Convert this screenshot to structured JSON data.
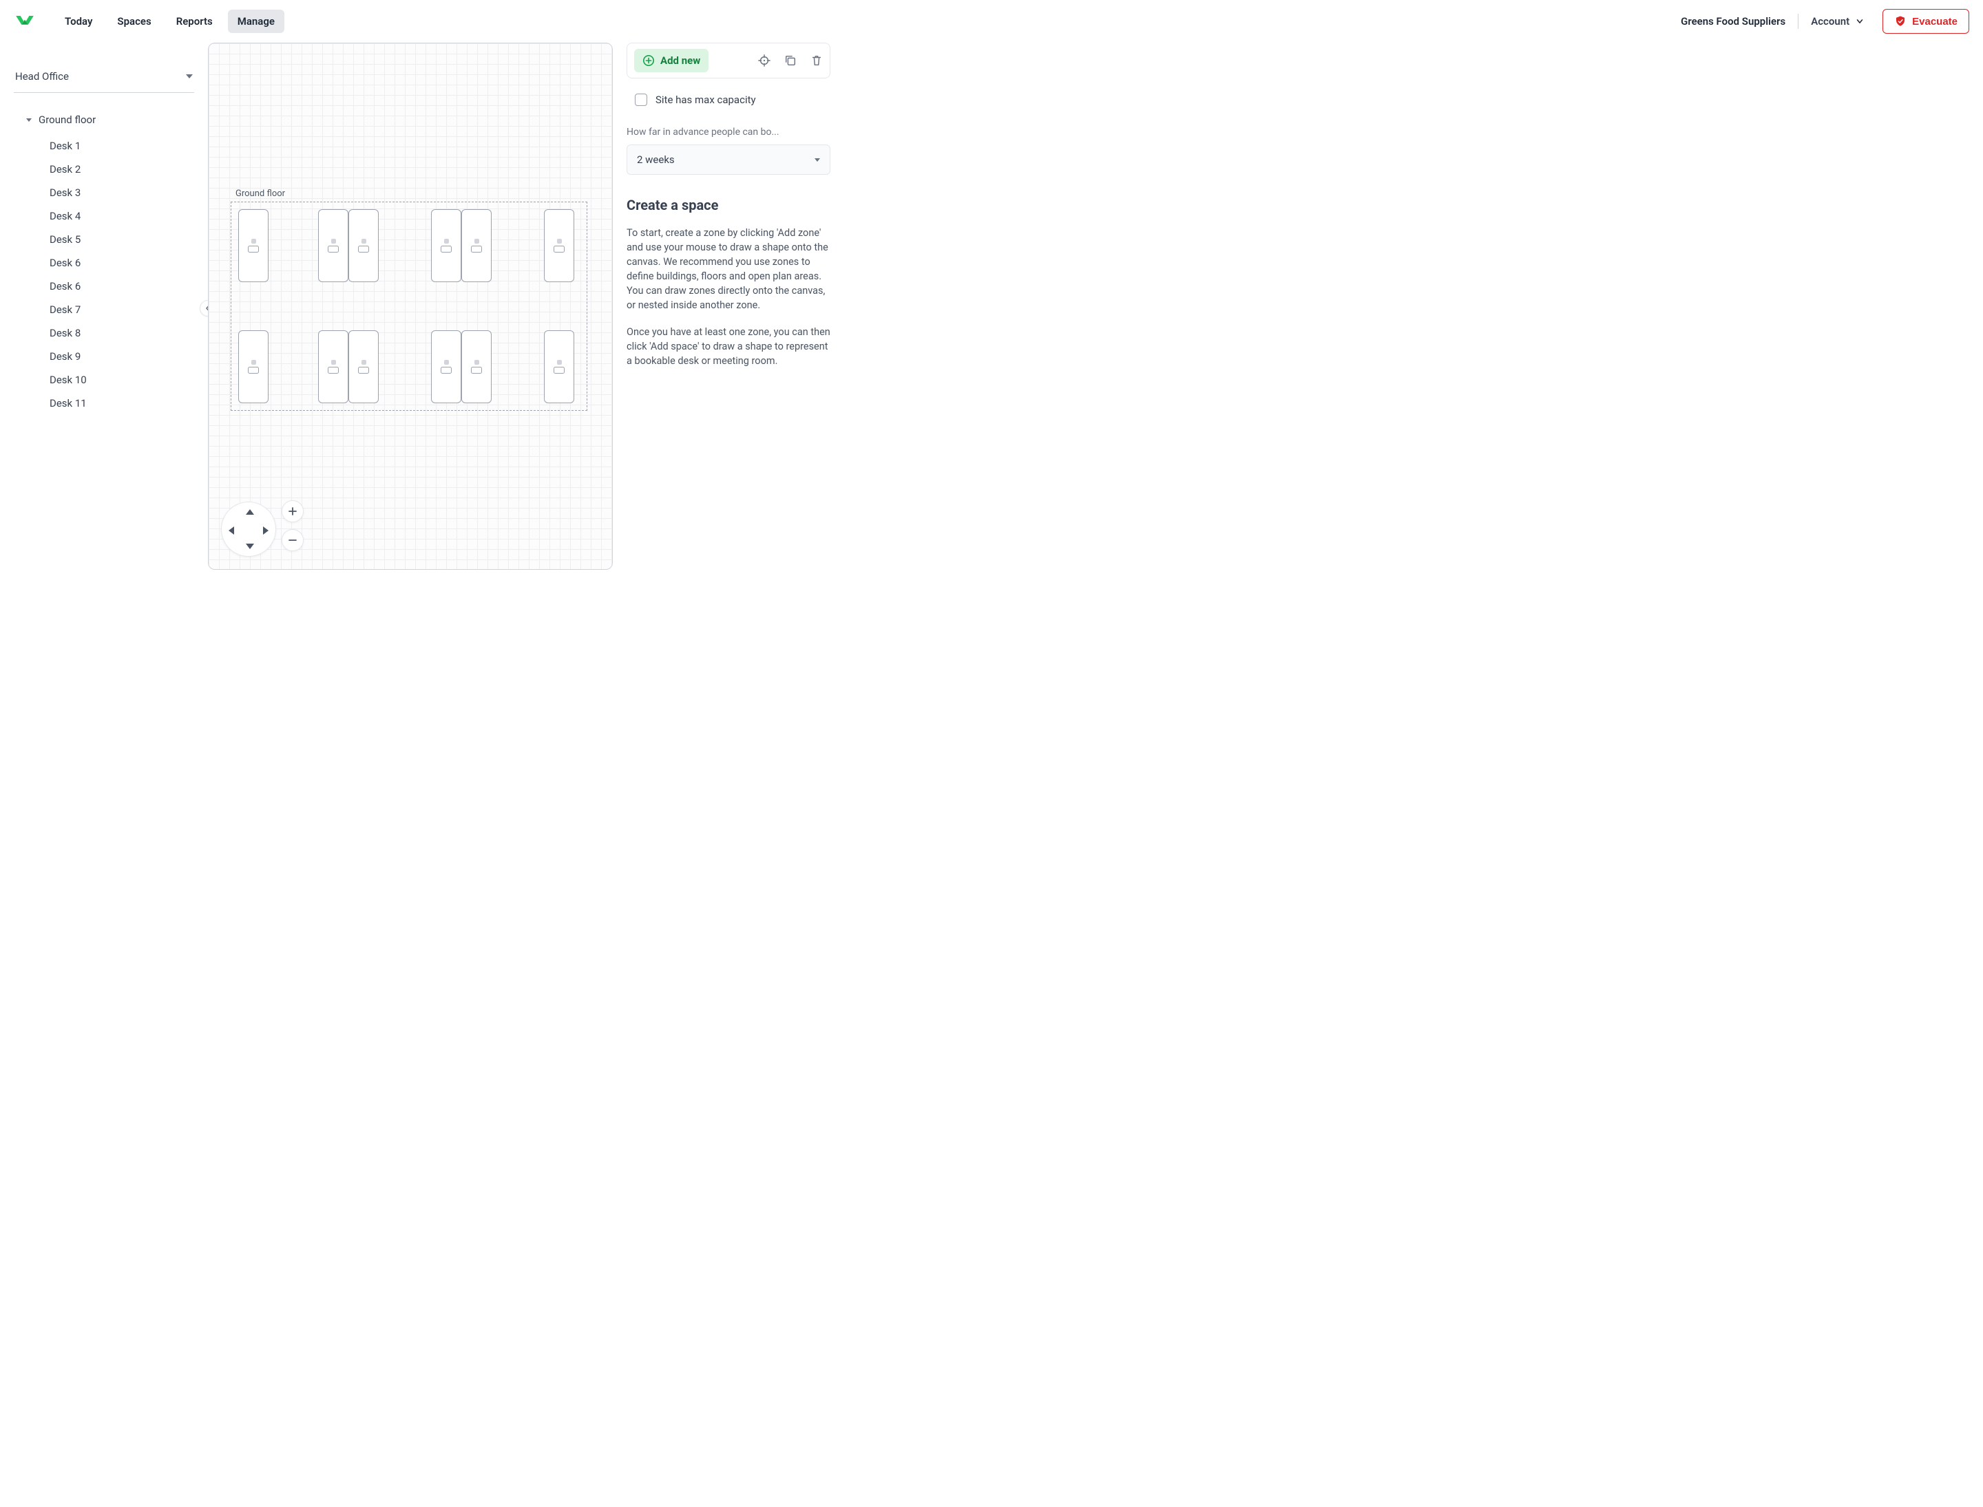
{
  "nav": {
    "items": [
      "Today",
      "Spaces",
      "Reports",
      "Manage"
    ],
    "active_index": 3
  },
  "header": {
    "org": "Greens Food Suppliers",
    "account_label": "Account",
    "evacuate_label": "Evacuate"
  },
  "sidebar": {
    "site": "Head Office",
    "zone": "Ground floor",
    "desks": [
      "Desk 1",
      "Desk 2",
      "Desk 3",
      "Desk 4",
      "Desk 5",
      "Desk 6",
      "Desk 6",
      "Desk 7",
      "Desk 8",
      "Desk 9",
      "Desk 10",
      "Desk 11"
    ]
  },
  "canvas": {
    "zone_label": "Ground floor"
  },
  "panel": {
    "add_new": "Add new",
    "max_capacity_label": "Site has max capacity",
    "advance_label": "How far in advance people can bo...",
    "advance_value": "2 weeks",
    "heading": "Create a space",
    "p1": "To start, create a zone by clicking 'Add zone' and use your mouse to draw a shape onto the canvas. We recommend you use zones to define buildings, floors and open plan areas. You can draw zones directly onto the canvas, or nested inside another zone.",
    "p2": "Once you have at least one zone, you can then click 'Add space' to draw a shape to represent a bookable desk or meeting room."
  }
}
